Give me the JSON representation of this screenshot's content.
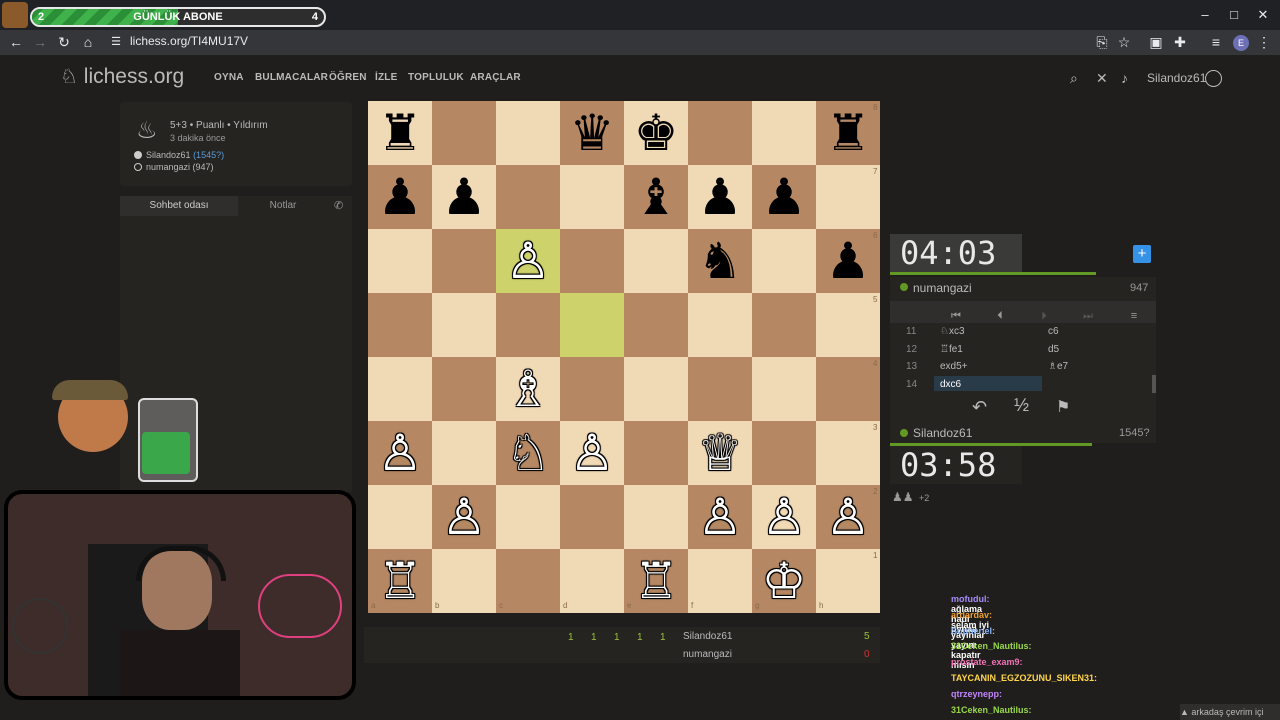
{
  "overlay": {
    "sub_goal_current": "2",
    "sub_goal_title": "GÜNLÜK ABONE",
    "sub_goal_target": "4",
    "sub_goal_progress": 0.5
  },
  "browser": {
    "url": "lichess.org/TI4MU17V",
    "profile_initial": "E"
  },
  "site": {
    "logo": "lichess.org",
    "nav": [
      "OYNA",
      "BULMACALAR",
      "ÖĞREN",
      "İZLE",
      "TOPLULUK",
      "ARAÇLAR"
    ],
    "username": "Silandoz61"
  },
  "game": {
    "title": "5+3 • Puanlı • Yıldırım",
    "time_ago": "3 dakika önce",
    "player_white": "Silandoz61",
    "player_white_rating": "(1545?)",
    "player_black": "numangazi",
    "player_black_rating": "(947)"
  },
  "chat": {
    "tab_chat": "Sohbet odası",
    "tab_notes": "Notlar"
  },
  "board": {
    "pieces": [
      {
        "sq": "a8",
        "g": "♜",
        "c": "b"
      },
      {
        "sq": "d8",
        "g": "♛",
        "c": "b"
      },
      {
        "sq": "e8",
        "g": "♚",
        "c": "b"
      },
      {
        "sq": "h8",
        "g": "♜",
        "c": "b"
      },
      {
        "sq": "a7",
        "g": "♟",
        "c": "b"
      },
      {
        "sq": "b7",
        "g": "♟",
        "c": "b"
      },
      {
        "sq": "e7",
        "g": "♝",
        "c": "b"
      },
      {
        "sq": "f7",
        "g": "♟",
        "c": "b"
      },
      {
        "sq": "g7",
        "g": "♟",
        "c": "b"
      },
      {
        "sq": "c6",
        "g": "♙",
        "c": "w"
      },
      {
        "sq": "f6",
        "g": "♞",
        "c": "b"
      },
      {
        "sq": "h6",
        "g": "♟",
        "c": "b"
      },
      {
        "sq": "c4",
        "g": "♗",
        "c": "w"
      },
      {
        "sq": "a3",
        "g": "♙",
        "c": "w"
      },
      {
        "sq": "c3",
        "g": "♘",
        "c": "w"
      },
      {
        "sq": "d3",
        "g": "♙",
        "c": "w"
      },
      {
        "sq": "f3",
        "g": "♕",
        "c": "w"
      },
      {
        "sq": "b2",
        "g": "♙",
        "c": "w"
      },
      {
        "sq": "f2",
        "g": "♙",
        "c": "w"
      },
      {
        "sq": "g2",
        "g": "♙",
        "c": "w"
      },
      {
        "sq": "h2",
        "g": "♙",
        "c": "w"
      },
      {
        "sq": "a1",
        "g": "♖",
        "c": "w"
      },
      {
        "sq": "e1",
        "g": "♖",
        "c": "w"
      },
      {
        "sq": "g1",
        "g": "♔",
        "c": "w"
      }
    ],
    "highlight": [
      "c6",
      "d5"
    ],
    "files": [
      "a",
      "b",
      "c",
      "d",
      "e",
      "f",
      "g",
      "h"
    ],
    "ranks": [
      "8",
      "7",
      "6",
      "5",
      "4",
      "3",
      "2",
      "1"
    ]
  },
  "clocks": {
    "top_time_min": "04",
    "top_time_sec": "03",
    "bottom_time_min": "03",
    "bottom_time_sec": "58",
    "top_player": "numangazi",
    "top_rating": "947",
    "bottom_player": "Silandoz61",
    "bottom_rating": "1545?",
    "spectators": "+2"
  },
  "moves": [
    {
      "n": "11",
      "w": "♘xc3",
      "b": "c6"
    },
    {
      "n": "12",
      "w": "♖fe1",
      "b": "d5"
    },
    {
      "n": "13",
      "w": "exd5+",
      "b": "♗e7"
    },
    {
      "n": "14",
      "w": "dxc6",
      "b": ""
    }
  ],
  "score": {
    "white_scores": [
      "1",
      "1",
      "1",
      "1",
      "1"
    ],
    "white_name": "Silandoz61",
    "white_total": "5",
    "black_name": "numangazi",
    "black_total": "0"
  },
  "stream_chat": [
    {
      "user": "mofudul:",
      "msg": "ağlama hadi pynaa",
      "color": "#a78bfa"
    },
    {
      "user": "ardardav:",
      "msg": "selam iyi yayınlar yayını kapatır mısın",
      "color": "#f0a030"
    },
    {
      "user": "Sopheriel:",
      "msg": "",
      "color": "#8ab4f8"
    },
    {
      "user": "31Ceken_Nautilus:",
      "msg": "",
      "color": "#9ad84a"
    },
    {
      "user": "prostate_exam9:",
      "msg": "",
      "color": "#f472b6"
    },
    {
      "user": "TAYCANIN_EGZOZUNU_SIKEN31:",
      "msg": "",
      "color": "#ffd54a"
    },
    {
      "user": "qtrzeynepp:",
      "msg": "",
      "color": "#c084fc"
    },
    {
      "user": "31Ceken_Nautilus:",
      "msg": "",
      "color": "#9ad84a"
    }
  ],
  "friends_online": "arkadaş çevrim içi"
}
